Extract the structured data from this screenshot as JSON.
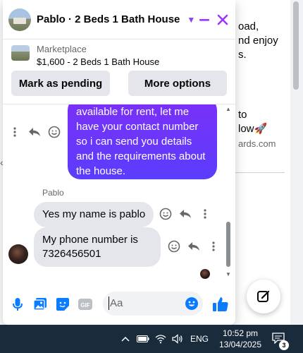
{
  "background": {
    "lines": [
      "oad,",
      "nd enjoy",
      "s."
    ],
    "cta_lines": [
      "to",
      "low🚀"
    ],
    "site": "ards.com"
  },
  "chat": {
    "header": {
      "title": "Pablo · 2 Beds 1 Bath House"
    },
    "marketplace": {
      "label": "Marketplace",
      "item": "$1,600 - 2 Beds 1 Bath House",
      "mark_pending": "Mark as pending",
      "more_options": "More options"
    },
    "messages": {
      "outgoing": "available for rent, let me have your contact number so i can send you details and the requirements about the house.",
      "sender": "Pablo",
      "incoming": [
        "Yes my name is pablo",
        "My phone number is 7326456501"
      ]
    },
    "composer": {
      "placeholder": "Aa",
      "gif_label": "GIF"
    }
  },
  "taskbar": {
    "language": "ENG",
    "time": "10:52 pm",
    "date": "13/04/2025",
    "notification_count": "3"
  },
  "colors": {
    "accent": "#a033ff",
    "bubble_out_top": "#7b2ff7",
    "bubble_out_bottom": "#5b3dff",
    "messenger_blue": "#0a7cff",
    "taskbar": "#1a2b3c"
  }
}
